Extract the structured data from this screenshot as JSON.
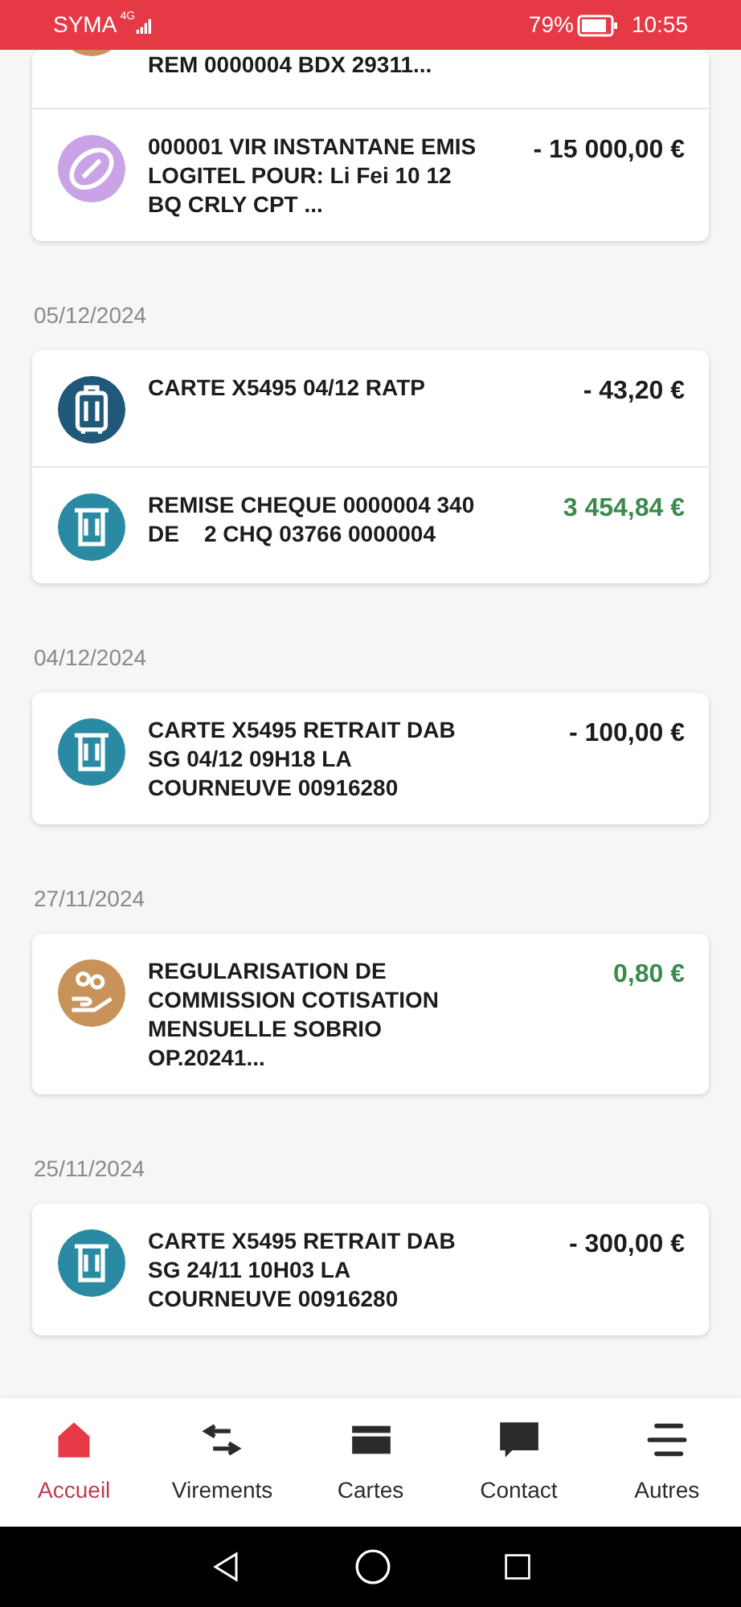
{
  "status_bar": {
    "carrier": "SYMA",
    "network": "4G",
    "battery": "79%",
    "time": "10:55"
  },
  "groups": [
    {
      "transactions": [
        {
          "kind": "savings",
          "label": "REM 0000004 BDX 29311..."
        },
        {
          "kind": "transfer",
          "label": "000001 VIR INSTANTANE EMIS LOGITEL POUR: Li Fei 10 12 BQ CRLY CPT ...",
          "amount": "- 15 000,00 €",
          "credit": false
        }
      ]
    },
    {
      "date": "05/12/2024",
      "transactions": [
        {
          "kind": "travel",
          "label": "CARTE X5495 04/12 RATP",
          "amount": "- 43,20 €",
          "credit": false
        },
        {
          "kind": "atm",
          "label": "REMISE CHEQUE 0000004 340 DE    2 CHQ 03766 0000004",
          "amount": "3 454,84 €",
          "credit": true
        }
      ]
    },
    {
      "date": "04/12/2024",
      "transactions": [
        {
          "kind": "atm",
          "label": "CARTE X5495 RETRAIT DAB SG 04/12 09H18 LA COURNEUVE 00916280",
          "amount": "- 100,00 €",
          "credit": false
        }
      ]
    },
    {
      "date": "27/11/2024",
      "transactions": [
        {
          "kind": "coins",
          "label": "REGULARISATION DE COMMISSION COTISATION MENSUELLE SOBRIO OP.20241...",
          "amount": "0,80 €",
          "credit": true
        }
      ]
    },
    {
      "date": "25/11/2024",
      "transactions": [
        {
          "kind": "atm",
          "label": "CARTE X5495 RETRAIT DAB SG 24/11 10H03 LA COURNEUVE 00916280",
          "amount": "- 300,00 €",
          "credit": false
        }
      ]
    }
  ],
  "nav": [
    {
      "kind": "home",
      "label": "Accueil",
      "selected": true
    },
    {
      "kind": "transfers",
      "label": "Virements",
      "selected": false
    },
    {
      "kind": "cards",
      "label": "Cartes",
      "selected": false
    },
    {
      "kind": "contact",
      "label": "Contact",
      "selected": false
    },
    {
      "kind": "more",
      "label": "Autres",
      "selected": false
    }
  ]
}
